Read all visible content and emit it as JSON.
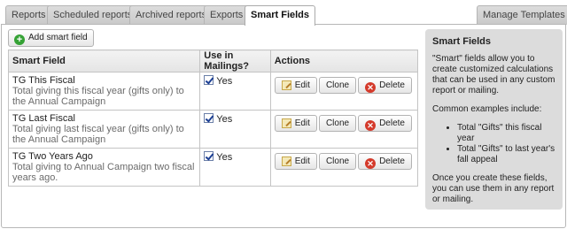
{
  "tabs": [
    {
      "label": "Reports",
      "active": false
    },
    {
      "label": "Scheduled reports",
      "active": false
    },
    {
      "label": "Archived reports",
      "active": false
    },
    {
      "label": "Exports",
      "active": false
    },
    {
      "label": "Smart Fields",
      "active": true
    }
  ],
  "manage_templates_label": "Manage Templates",
  "add_button_label": "Add smart field",
  "table": {
    "headers": {
      "field": "Smart Field",
      "use": "Use in Mailings?",
      "actions": "Actions"
    },
    "rows": [
      {
        "name": "TG This Fiscal",
        "description": "Total giving this fiscal year (gifts only) to the Annual Campaign",
        "use": "Yes",
        "use_checked": true
      },
      {
        "name": "TG Last Fiscal",
        "description": "Total giving last fiscal year (gifts only) to the Annual Campaign",
        "use": "Yes",
        "use_checked": true
      },
      {
        "name": "TG Two Years Ago",
        "description": "Total giving to Annual Campaign two fiscal years ago.",
        "use": "Yes",
        "use_checked": true
      }
    ],
    "action_labels": {
      "edit": "Edit",
      "clone": "Clone",
      "delete": "Delete"
    }
  },
  "aside": {
    "title": "Smart Fields",
    "intro": "\"Smart\" fields allow you to create customized calculations that can be used in any custom report or mailing.",
    "examples_heading": "Common examples include:",
    "examples": [
      "Total \"Gifts\" this fiscal year",
      "Total \"Gifts\" to last year's fall appeal"
    ],
    "footer": "Once you create these fields, you can use them in any report or mailing."
  },
  "icons": {
    "add": "plus-circle-icon",
    "edit": "pencil-icon",
    "delete": "x-circle-icon",
    "check": "checkbox-checked-icon"
  },
  "colors": {
    "add_icon": "#35a235",
    "delete_icon": "#d43a2b",
    "aside_bg": "#dcdcdc",
    "description_text": "#6b6b6b"
  }
}
